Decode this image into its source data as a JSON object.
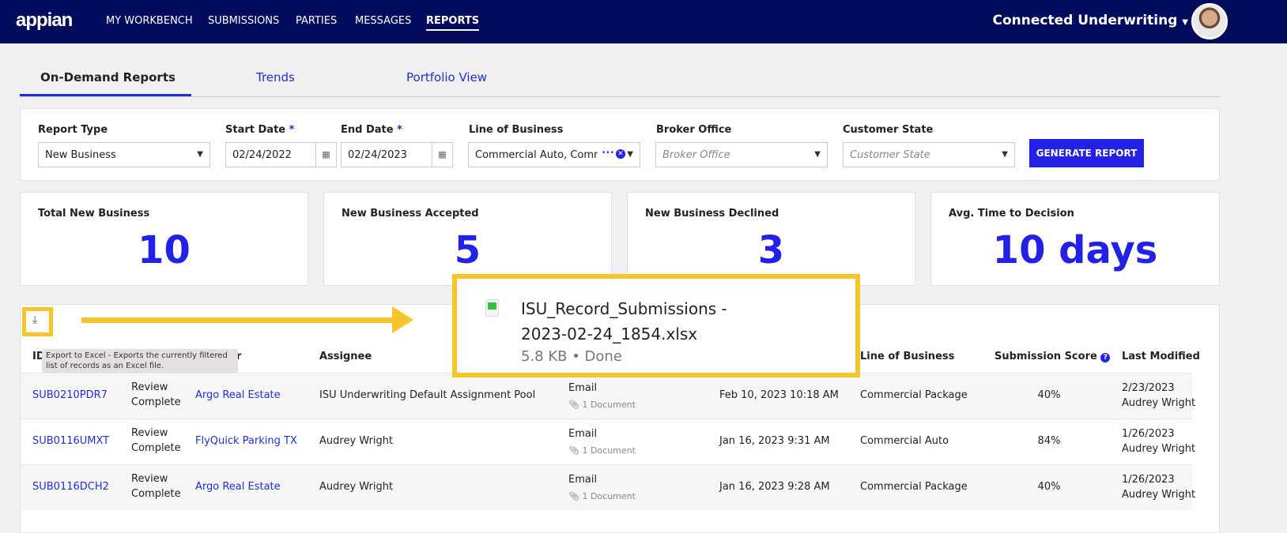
{
  "header": {
    "logo": "appian",
    "nav": [
      "MY WORKBENCH",
      "SUBMISSIONS",
      "PARTIES",
      "MESSAGES",
      "REPORTS"
    ],
    "active": "REPORTS",
    "app_name": "Connected Underwriting"
  },
  "tabs": [
    "On-Demand Reports",
    "Trends",
    "Portfolio View"
  ],
  "filters": {
    "report_type": {
      "label": "Report Type",
      "value": "New Business"
    },
    "start_date": {
      "label": "Start Date",
      "required": "*",
      "value": "02/24/2022"
    },
    "end_date": {
      "label": "End Date",
      "required": "*",
      "value": "02/24/2023"
    },
    "line_of_business": {
      "label": "Line of Business",
      "value": "Commercial Auto, Comm",
      "more": "•••"
    },
    "broker_office": {
      "label": "Broker Office",
      "placeholder": "Broker Office"
    },
    "customer_state": {
      "label": "Customer State",
      "placeholder": "Customer State"
    },
    "generate": "GENERATE REPORT"
  },
  "kpis": [
    {
      "label": "Total New Business",
      "value": "10"
    },
    {
      "label": "New Business Accepted",
      "value": "5"
    },
    {
      "label": "New Business Declined",
      "value": "3"
    },
    {
      "label": "Avg. Time to Decision",
      "value": "10 days"
    }
  ],
  "export": {
    "tooltip": "Export to Excel - Exports the currently filtered list of records as an Excel file."
  },
  "download": {
    "filename": "ISU_Record_Submissions - 2023-02-24_1854.xlsx",
    "status": "5.8 KB • Done"
  },
  "table": {
    "headers": {
      "id": "ID",
      "customer_fragment": "er",
      "assignee": "Assignee",
      "lob": "Line of Business",
      "score": "Submission Score",
      "modified": "Last Modified"
    },
    "rows": [
      {
        "id": "SUB0210PDR7",
        "status": "Review Complete",
        "customer": "Argo Real Estate",
        "assignee": "ISU Underwriting Default Assignment Pool",
        "channel": "Email",
        "docs": "1 Document",
        "date": "Feb 10, 2023 10:18 AM",
        "lob": "Commercial Package",
        "score": "40%",
        "mod_date": "2/23/2023",
        "mod_by": "Audrey Wright"
      },
      {
        "id": "SUB0116UMXT",
        "status": "Review Complete",
        "customer": "FlyQuick Parking TX",
        "assignee": "Audrey Wright",
        "channel": "Email",
        "docs": "1 Document",
        "date": "Jan 16, 2023 9:31 AM",
        "lob": "Commercial Auto",
        "score": "84%",
        "mod_date": "1/26/2023",
        "mod_by": "Audrey Wright"
      },
      {
        "id": "SUB0116DCH2",
        "status": "Review Complete",
        "customer": "Argo Real Estate",
        "assignee": "Audrey Wright",
        "channel": "Email",
        "docs": "1 Document",
        "date": "Jan 16, 2023 9:28 AM",
        "lob": "Commercial Package",
        "score": "40%",
        "mod_date": "1/26/2023",
        "mod_by": "Audrey Wright"
      }
    ]
  },
  "colors": {
    "navy": "#020b5c",
    "accent": "#2421e6",
    "highlight": "#f7c52b"
  }
}
